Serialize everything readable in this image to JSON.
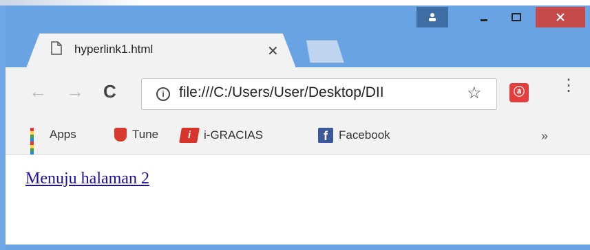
{
  "window": {
    "controls": {
      "user": "user-icon",
      "minimize": "minimize-icon",
      "maximize": "maximize-icon",
      "close": "close-icon"
    }
  },
  "tabs": [
    {
      "title": "hyperlink1.html",
      "icon": "page-icon",
      "close_glyph": "✕"
    }
  ],
  "toolbar": {
    "back_glyph": "←",
    "forward_glyph": "→",
    "reload_glyph": "C",
    "address": "file:///C:/Users/User/Desktop/DII",
    "info_glyph": "i",
    "star_glyph": "☆",
    "extension_glyph": "ⓐ",
    "menu_glyph": "⋮"
  },
  "bookmarks": [
    {
      "label": "Apps",
      "icon": "apps-grid-icon"
    },
    {
      "label": "Tune",
      "icon": "tune-icon"
    },
    {
      "label": "i-GRACIAS",
      "icon": "igracias-icon"
    },
    {
      "label": "Facebook",
      "icon": "facebook-icon"
    }
  ],
  "bookmarks_more": "»",
  "page": {
    "link_text": "Menuju halaman 2"
  },
  "colors": {
    "frame": "#6aa3e4",
    "close_button": "#c74a4a",
    "link": "#1a0dab"
  }
}
